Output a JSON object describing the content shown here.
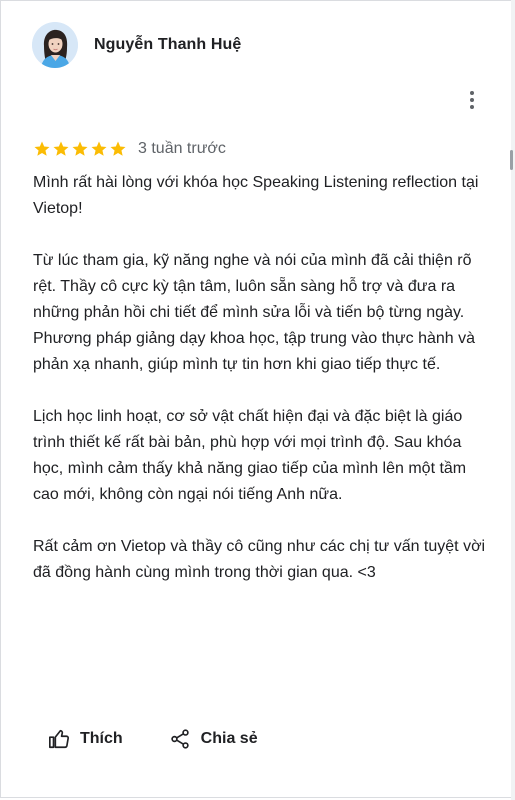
{
  "review": {
    "author_name": "Nguyễn Thanh Huệ",
    "rating": 5,
    "max_rating": 5,
    "time_ago": "3 tuần trước",
    "paragraphs": [
      "Mình rất hài lòng với khóa học Speaking Listening reflection tại Vietop!",
      "Từ lúc tham gia, kỹ năng nghe và nói của mình đã cải thiện rõ rệt. Thầy cô cực kỳ tận tâm, luôn sẵn sàng hỗ trợ và đưa ra những phản hồi chi tiết để mình sửa lỗi và tiến bộ từng ngày. Phương pháp giảng dạy khoa học, tập trung vào thực hành và phản xạ nhanh, giúp mình tự tin hơn khi giao tiếp thực tế.",
      "Lịch học linh hoạt, cơ sở vật chất hiện đại và đặc biệt là giáo trình thiết kế rất bài bản, phù hợp với mọi trình độ. Sau khóa học, mình cảm thấy khả năng giao tiếp của mình lên một tầm cao mới, không còn ngại nói tiếng Anh nữa.",
      "Rất cảm ơn Vietop và thầy cô cũng như các chị tư vấn tuyệt vời đã đồng hành cùng mình trong thời gian qua. <3"
    ]
  },
  "actions": {
    "like_label": "Thích",
    "share_label": "Chia sẻ"
  },
  "icons": {
    "avatar": "avatar-photo",
    "more": "more-vert-icon",
    "star": "star-icon",
    "like": "thumb-up-icon",
    "share": "share-icon"
  },
  "colors": {
    "star": "#fbbc04",
    "text": "#202124",
    "secondary_text": "#5f6368",
    "border": "#dadce0"
  }
}
